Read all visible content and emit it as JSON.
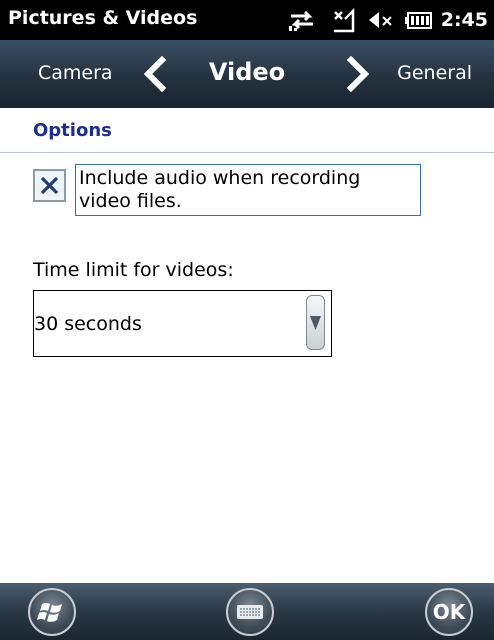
{
  "status_bar": {
    "title": "Pictures & Videos",
    "time": "2:45",
    "icons": [
      "connectivity-icon",
      "no-signal-icon",
      "volume-muted-icon",
      "battery-icon"
    ]
  },
  "tabs": {
    "previous": "Camera",
    "current": "Video",
    "next": "General"
  },
  "section": {
    "title": "Options"
  },
  "include_audio": {
    "label": "Include audio when recording video files.",
    "checked": true
  },
  "time_limit": {
    "label": "Time limit for videos:",
    "value": "30 seconds"
  },
  "softkeys": {
    "left_icon": "windows-start-icon",
    "center_icon": "keyboard-icon",
    "right_label": "OK"
  }
}
